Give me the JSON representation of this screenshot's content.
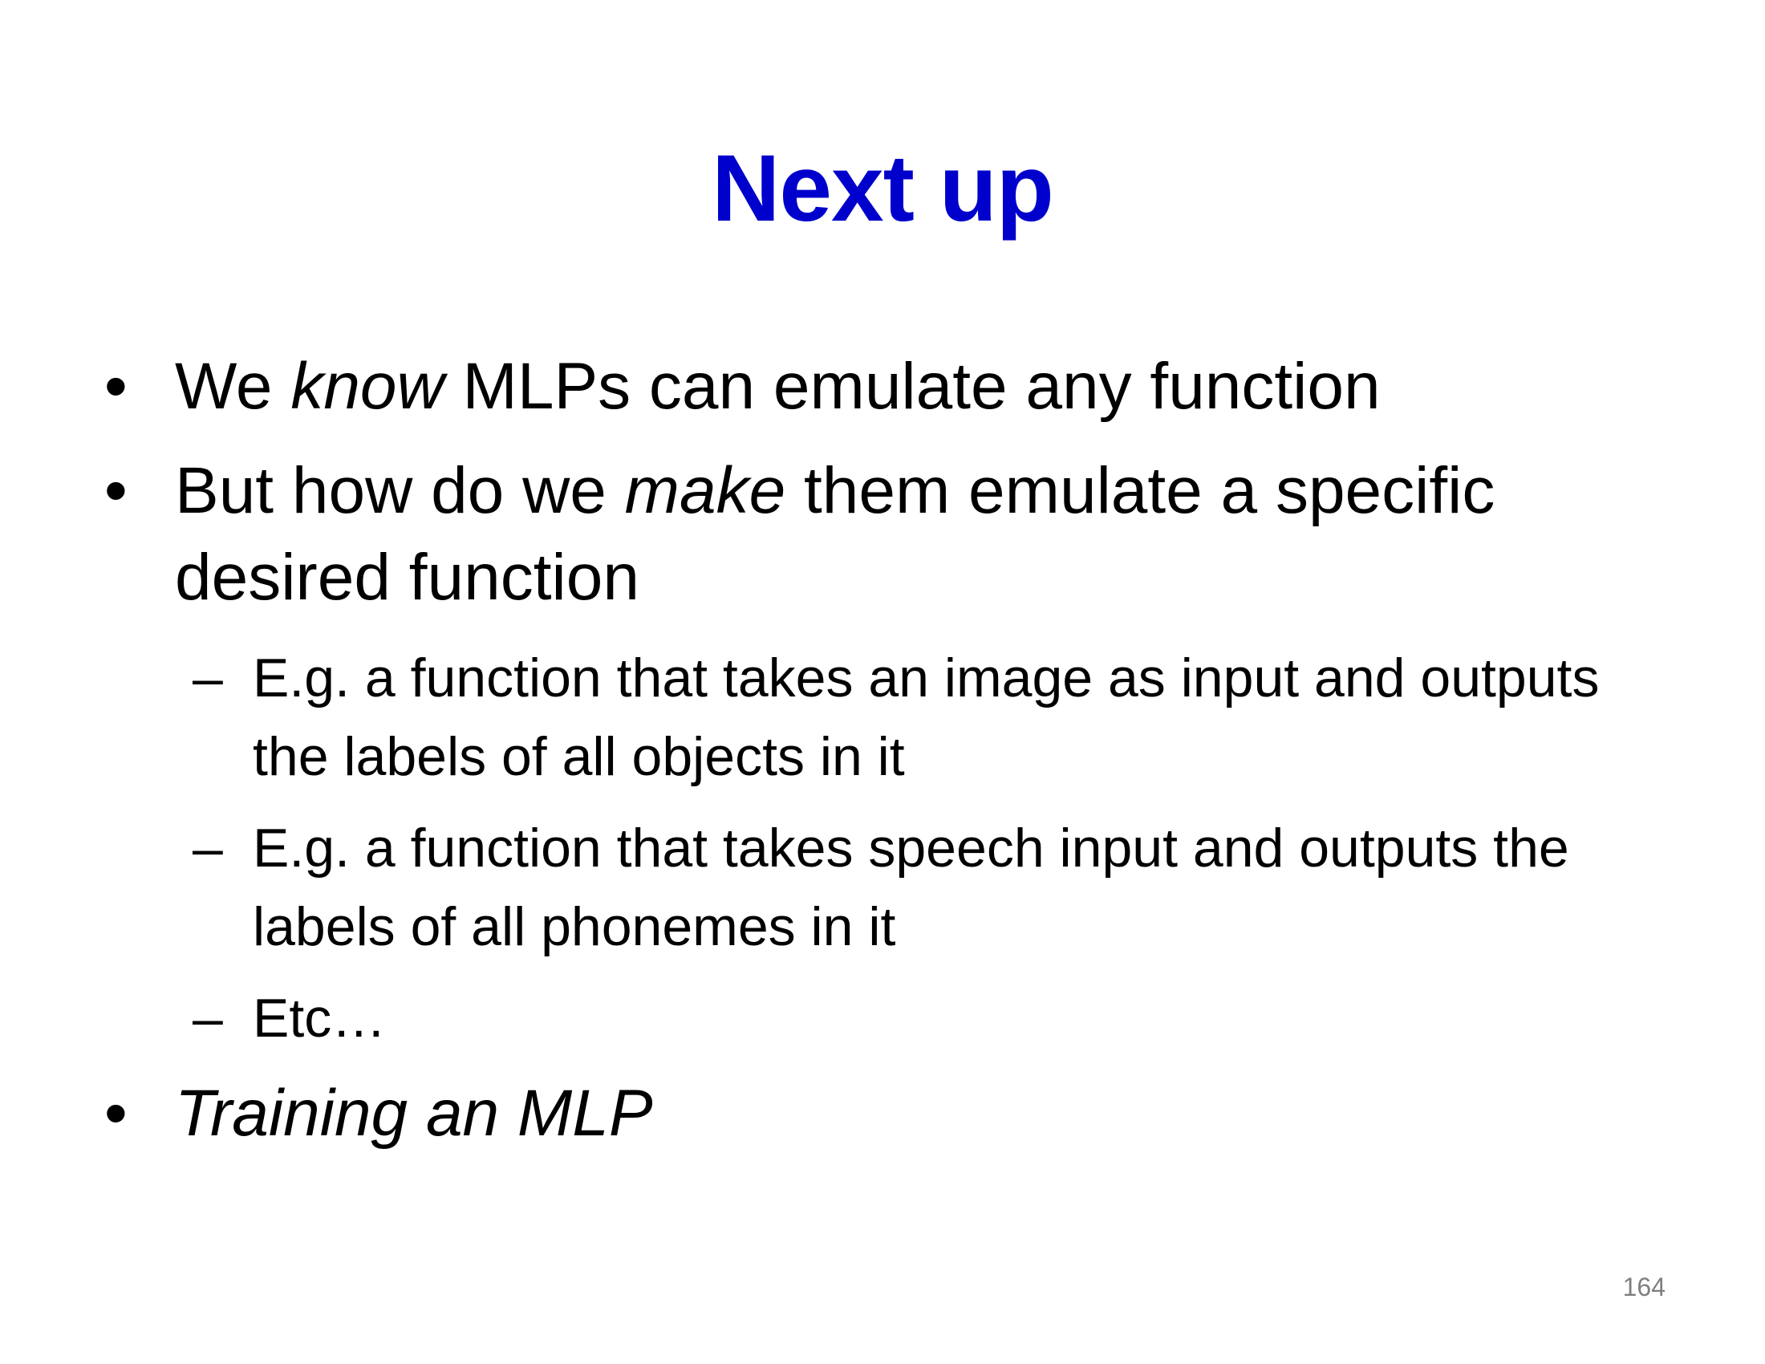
{
  "slide": {
    "title": "Next up",
    "title_color": "#0000cc",
    "page_number": "164",
    "bullets": [
      {
        "marker": "•",
        "pre": "We ",
        "em": "know",
        "post": " MLPs can emulate any function"
      },
      {
        "marker": "•",
        "pre": "But how do we ",
        "em": "make",
        "post": " them emulate a specific desired function"
      },
      {
        "marker": "–",
        "text": "E.g. a function that takes an image as input and outputs the labels of all objects in it"
      },
      {
        "marker": "–",
        "text": "E.g. a function that takes speech input and outputs the labels of all phonemes in it"
      },
      {
        "marker": "–",
        "text": "Etc…"
      },
      {
        "marker": "•",
        "em": "Training an MLP"
      }
    ]
  }
}
